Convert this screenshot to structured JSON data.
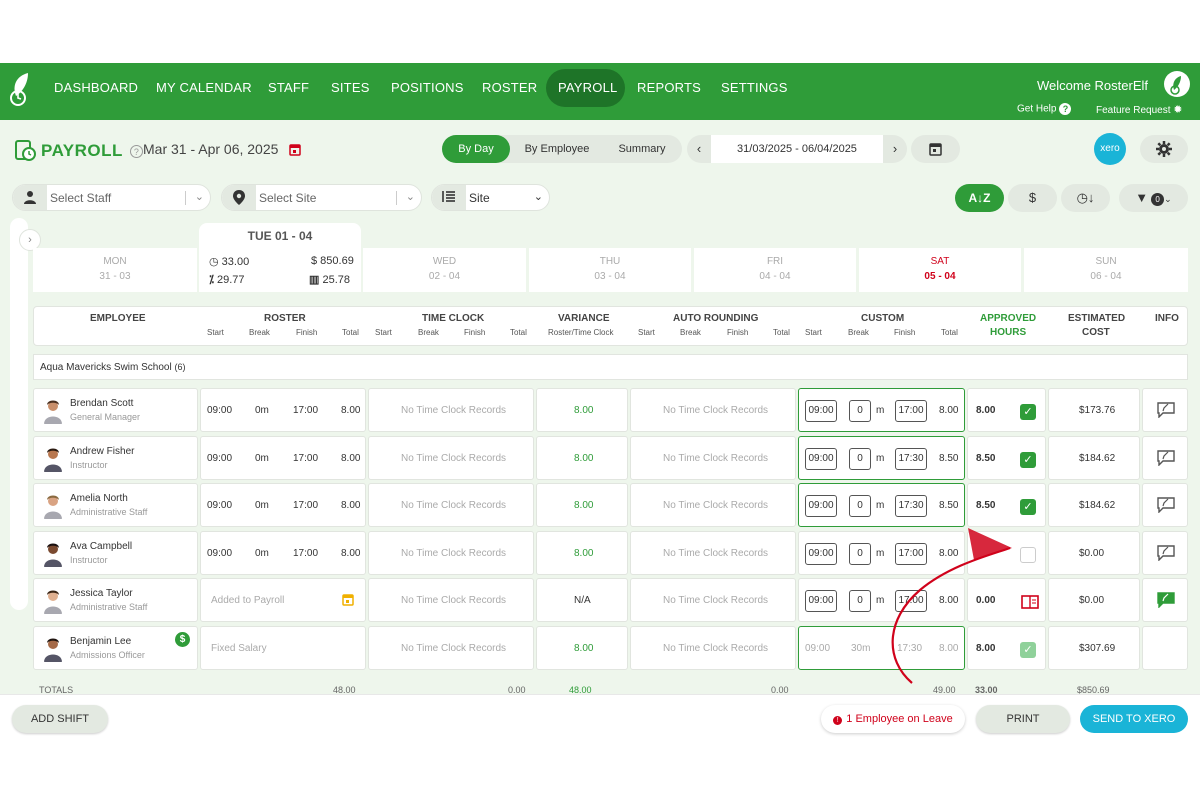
{
  "nav": {
    "items": [
      "DASHBOARD",
      "MY CALENDAR",
      "STAFF",
      "SITES",
      "POSITIONS",
      "ROSTER",
      "PAYROLL",
      "REPORTS",
      "SETTINGS"
    ],
    "welcome": "Welcome RosterElf",
    "get_help": "Get Help",
    "feature_request": "Feature Request"
  },
  "header": {
    "title": "PAYROLL",
    "date_range": "Mar 31 - Apr 06, 2025",
    "view_tabs": [
      "By Day",
      "By Employee",
      "Summary"
    ],
    "active_tab": "By Day",
    "date_input": "31/03/2025 - 06/04/2025",
    "xero_label": "xero"
  },
  "filters": {
    "staff_placeholder": "Select Staff",
    "site_placeholder": "Select Site",
    "group_by": "Site",
    "filter_count": "0"
  },
  "days": [
    {
      "name": "MON",
      "date": "31 - 03"
    },
    {
      "name": "WED",
      "date": "02 - 04"
    },
    {
      "name": "THU",
      "date": "03 - 04"
    },
    {
      "name": "FRI",
      "date": "04 - 04"
    },
    {
      "name": "SAT",
      "date": "05 - 04"
    },
    {
      "name": "SUN",
      "date": "06 - 04"
    }
  ],
  "selected_day": {
    "label": "TUE 01 - 04",
    "hours": "33.00",
    "cost": "$ 850.69",
    "percent": "29.77",
    "stat": "25.78"
  },
  "columns": {
    "employee": "EMPLOYEE",
    "roster": "ROSTER",
    "time_clock": "TIME CLOCK",
    "variance": "VARIANCE",
    "variance_sub": "Roster/Time Clock",
    "auto_rounding": "AUTO ROUNDING",
    "custom": "CUSTOM",
    "approved_1": "APPROVED",
    "approved_2": "HOURS",
    "est_1": "ESTIMATED",
    "est_2": "COST",
    "info": "INFO",
    "start": "Start",
    "break": "Break",
    "finish": "Finish",
    "total": "Total"
  },
  "group": {
    "name": "Aqua Mavericks Swim School",
    "count": "(6)"
  },
  "rows": [
    {
      "name": "Brendan Scott",
      "position": "General Manager",
      "r_start": "09:00",
      "r_break": "0m",
      "r_finish": "17:00",
      "r_total": "8.00",
      "tc": "No Time Clock Records",
      "variance": "8.00",
      "ar": "No Time Clock Records",
      "c_start": "09:00",
      "c_break": "0",
      "c_unit": "m",
      "c_finish": "17:00",
      "c_total": "8.00",
      "approved": "8.00",
      "cost": "$173.76"
    },
    {
      "name": "Andrew Fisher",
      "position": "Instructor",
      "r_start": "09:00",
      "r_break": "0m",
      "r_finish": "17:00",
      "r_total": "8.00",
      "tc": "No Time Clock Records",
      "variance": "8.00",
      "ar": "No Time Clock Records",
      "c_start": "09:00",
      "c_break": "0",
      "c_unit": "m",
      "c_finish": "17:30",
      "c_total": "8.50",
      "approved": "8.50",
      "cost": "$184.62"
    },
    {
      "name": "Amelia North",
      "position": "Administrative Staff",
      "r_start": "09:00",
      "r_break": "0m",
      "r_finish": "17:00",
      "r_total": "8.00",
      "tc": "No Time Clock Records",
      "variance": "8.00",
      "ar": "No Time Clock Records",
      "c_start": "09:00",
      "c_break": "0",
      "c_unit": "m",
      "c_finish": "17:30",
      "c_total": "8.50",
      "approved": "8.50",
      "cost": "$184.62"
    },
    {
      "name": "Ava Campbell",
      "position": "Instructor",
      "r_start": "09:00",
      "r_break": "0m",
      "r_finish": "17:00",
      "r_total": "8.00",
      "tc": "No Time Clock Records",
      "variance": "8.00",
      "ar": "No Time Clock Records",
      "c_start": "09:00",
      "c_break": "0",
      "c_unit": "m",
      "c_finish": "17:00",
      "c_total": "8.00",
      "approved": "",
      "cost": "$0.00"
    },
    {
      "name": "Jessica Taylor",
      "position": "Administrative Staff",
      "roster_note": "Added to Payroll",
      "tc": "No Time Clock Records",
      "variance": "N/A",
      "ar": "No Time Clock Records",
      "c_start": "09:00",
      "c_break": "0",
      "c_unit": "m",
      "c_finish": "17:00",
      "c_total": "8.00",
      "approved": "0.00",
      "cost": "$0.00"
    },
    {
      "name": "Benjamin Lee",
      "position": "Admissions Officer",
      "roster_note": "Fixed Salary",
      "tc": "No Time Clock Records",
      "variance": "8.00",
      "ar": "No Time Clock Records",
      "c_start": "09:00",
      "c_break": "30m",
      "c_finish": "17:30",
      "c_total": "8.00",
      "approved": "8.00",
      "cost": "$307.69"
    }
  ],
  "totals": {
    "label": "TOTALS",
    "roster": "48.00",
    "tc": "0.00",
    "variance": "48.00",
    "ar": "0.00",
    "custom": "49.00",
    "approved": "33.00",
    "cost": "$850.69"
  },
  "bottom": {
    "add_shift": "ADD SHIFT",
    "leave": "1 Employee on Leave",
    "print": "PRINT",
    "send": "SEND TO XERO"
  },
  "colors": {
    "brand_green": "#2f9c39",
    "dark_green": "#1e7428",
    "xero_blue": "#1ab4d7",
    "alert_red": "#d0021b"
  }
}
